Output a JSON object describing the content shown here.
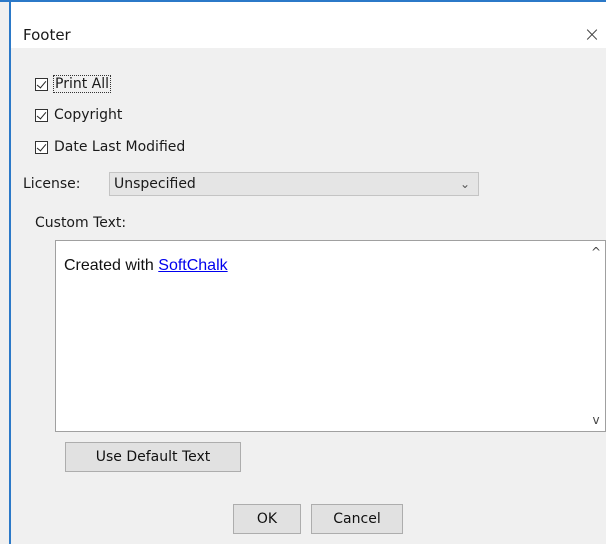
{
  "window": {
    "title": "Footer",
    "close_icon": "×",
    "accent_color": "#2b79c8"
  },
  "checkboxes": [
    {
      "label": "Print All",
      "checked": true
    },
    {
      "label": "Copyright",
      "checked": true
    },
    {
      "label": "Date Last Modified",
      "checked": true
    }
  ],
  "license": {
    "label": "License:",
    "selected": "Unspecified",
    "chevron_icon": "chevron-down-icon"
  },
  "custom_text": {
    "label": "Custom Text:",
    "prefix": "Created with ",
    "link_text": "SoftChalk",
    "scroll_up": "^",
    "scroll_down": "v"
  },
  "buttons": {
    "default_text": "Use Default Text",
    "ok": "OK",
    "cancel": "Cancel"
  }
}
